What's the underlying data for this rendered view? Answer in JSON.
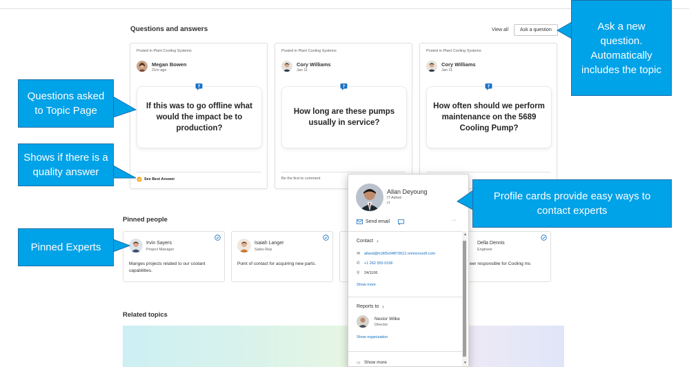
{
  "sections": {
    "qa_title": "Questions and answers",
    "view_all": "View all",
    "ask_button": "Ask a question",
    "pinned_title": "Pinned people",
    "related_title": "Related topics"
  },
  "questions": [
    {
      "posted": "Posted in Plant Cooling Systems",
      "author": "Megan Bowen",
      "date": "21m ago",
      "text": "If this was to go offline what would the impact be to production?",
      "footer": "See Best Answer"
    },
    {
      "posted": "Posted in Plant Cooling Systems",
      "author": "Cory Williams",
      "date": "Jan 11",
      "text": "How long are these pumps usually in service?",
      "footer": "Be the first to comment"
    },
    {
      "posted": "Posted in Plant Cooling Systems",
      "author": "Cory Williams",
      "date": "Jan 11",
      "text": "How often should we perform maintenance on the 5689 Cooling Pump?",
      "footer": ""
    }
  ],
  "people": [
    {
      "name": "Irvin Sayers",
      "role": "Project Manager",
      "desc": "Manges projects related to our coolant capabilities."
    },
    {
      "name": "Isaiah Langer",
      "role": "Sales Rep",
      "desc": "Point of contact for acquiring new parts."
    },
    {
      "name": "Della Dennis",
      "role": "Engineer",
      "desc": "eer responsible for Cooling ms"
    }
  ],
  "profile": {
    "name": "Allan Deyoung",
    "title": "IT Admin",
    "dept": "IT",
    "send_email": "Send email",
    "more": "···",
    "contact_header": "Contact",
    "email": "alland@m365x94873612.onmicrosoft.com",
    "phone": "+1 262 555 0106",
    "office": "24/1106",
    "show_more": "Show more",
    "reports_header": "Reports to",
    "manager_name": "Nestor Wilke",
    "manager_title": "Director",
    "show_org": "Show organization",
    "show_more_bottom": "Show more"
  },
  "callouts": {
    "ask": "Ask a new question. Automatically includes the topic",
    "questions": "Questions asked to Topic Page",
    "quality": "Shows if there is a quality answer",
    "pinned": "Pinned Experts",
    "profile": "Profile cards provide easy ways to contact experts"
  },
  "colors": {
    "callout_fill": "#00a2e8",
    "callout_border": "#1a6fa8",
    "link_blue": "#0f6cbd",
    "best_answer": "#f7a21b"
  },
  "icons": [
    "question-bubble-icon",
    "best-answer-icon",
    "verified-check-icon",
    "mail-icon",
    "chat-icon",
    "phone-icon",
    "location-icon",
    "chevron-right-icon"
  ]
}
